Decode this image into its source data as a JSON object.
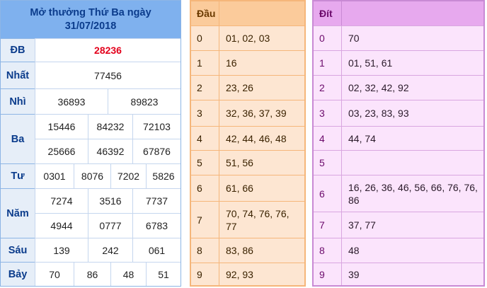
{
  "results": {
    "header_line1": "Mở thưởng Thứ Ba ngày",
    "header_line2": "31/07/2018",
    "rows": [
      {
        "label": "ĐB",
        "values": [
          "28236"
        ]
      },
      {
        "label": "Nhất",
        "values": [
          "77456"
        ]
      },
      {
        "label": "Nhì",
        "values": [
          "36893",
          "89823"
        ]
      },
      {
        "label": "Ba",
        "values": [
          "15446",
          "84232",
          "72103",
          "25666",
          "46392",
          "67876"
        ]
      },
      {
        "label": "Tư",
        "values": [
          "0301",
          "8076",
          "7202",
          "5826"
        ]
      },
      {
        "label": "Năm",
        "values": [
          "7274",
          "3516",
          "7737",
          "4944",
          "0777",
          "6783"
        ]
      },
      {
        "label": "Sáu",
        "values": [
          "139",
          "242",
          "061"
        ]
      },
      {
        "label": "Bảy",
        "values": [
          "70",
          "86",
          "48",
          "51"
        ]
      }
    ]
  },
  "dau": {
    "header": "Đầu",
    "rows": [
      {
        "key": "0",
        "value": "01, 02, 03"
      },
      {
        "key": "1",
        "value": "16"
      },
      {
        "key": "2",
        "value": "23, 26"
      },
      {
        "key": "3",
        "value": "32, 36, 37, 39"
      },
      {
        "key": "4",
        "value": "42, 44, 46, 48"
      },
      {
        "key": "5",
        "value": "51, 56"
      },
      {
        "key": "6",
        "value": "61, 66"
      },
      {
        "key": "7",
        "value": "70, 74, 76, 76, 77"
      },
      {
        "key": "8",
        "value": "83, 86"
      },
      {
        "key": "9",
        "value": "92, 93"
      }
    ]
  },
  "dit": {
    "header": "Đít",
    "rows": [
      {
        "key": "0",
        "value": "70"
      },
      {
        "key": "1",
        "value": "01, 51, 61"
      },
      {
        "key": "2",
        "value": "02, 32, 42, 92"
      },
      {
        "key": "3",
        "value": "03, 23, 83, 93"
      },
      {
        "key": "4",
        "value": "44, 74"
      },
      {
        "key": "5",
        "value": ""
      },
      {
        "key": "6",
        "value": "16, 26, 36, 46, 56, 66, 76, 76, 86"
      },
      {
        "key": "7",
        "value": "37, 77"
      },
      {
        "key": "8",
        "value": "48"
      },
      {
        "key": "9",
        "value": "39"
      }
    ]
  }
}
